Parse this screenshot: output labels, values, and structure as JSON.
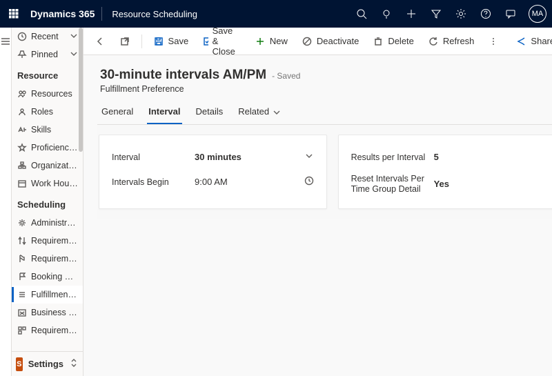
{
  "topbar": {
    "brand": "Dynamics 365",
    "app": "Resource Scheduling",
    "avatar": "MA"
  },
  "sidebar": {
    "recent": "Recent",
    "pinned": "Pinned",
    "group_resource": "Resource",
    "resource_items": [
      "Resources",
      "Roles",
      "Skills",
      "Proficiency Models",
      "Organizational Un...",
      "Work Hours Temp..."
    ],
    "group_scheduling": "Scheduling",
    "scheduling_items": [
      "Administration",
      "Requirement Prior...",
      "Requirement Stat...",
      "Booking Statuses",
      "Fulfillment Prefer...",
      "Business Closures",
      "Requirement Gro..."
    ],
    "area_badge": "S",
    "area_label": "Settings"
  },
  "cmdbar": {
    "save": "Save",
    "save_close": "Save & Close",
    "new": "New",
    "deactivate": "Deactivate",
    "delete": "Delete",
    "refresh": "Refresh",
    "share": "Share"
  },
  "page": {
    "title": "30-minute intervals AM/PM",
    "status": "- Saved",
    "subtitle": "Fulfillment Preference",
    "tabs": [
      "General",
      "Interval",
      "Details",
      "Related"
    ],
    "active_tab": 1
  },
  "form": {
    "left": [
      {
        "label": "Interval",
        "value": "30 minutes",
        "trail": "chev"
      },
      {
        "label": "Intervals Begin",
        "value": "9:00 AM",
        "trail": "clock"
      }
    ],
    "right": [
      {
        "label": "Results per Interval",
        "value": "5"
      },
      {
        "label": "Reset Intervals Per Time Group Detail",
        "value": "Yes"
      }
    ]
  }
}
